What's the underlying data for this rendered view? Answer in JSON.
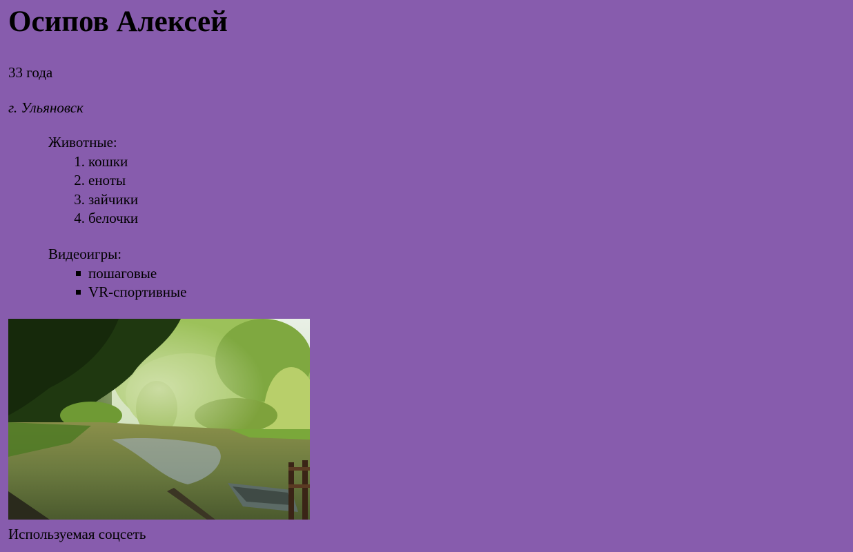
{
  "profile": {
    "name": "Осипов Алексей",
    "age": "33 года",
    "city": "г. Ульяновск"
  },
  "animals": {
    "title": "Животные:",
    "items": [
      {
        "num": "1.",
        "label": "кошки"
      },
      {
        "num": "2.",
        "label": "еноты"
      },
      {
        "num": "3.",
        "label": "зайчики"
      },
      {
        "num": "4.",
        "label": "белочки"
      }
    ]
  },
  "games": {
    "title": "Видеоигры:",
    "items": [
      {
        "label": "пошаговые"
      },
      {
        "label": "VR-спортивные"
      }
    ]
  },
  "photo": {
    "subject": "park pond with trees and boat"
  },
  "footer": {
    "social_label": "Используемая соцсеть"
  },
  "colors": {
    "background": "#875cad",
    "text": "#000000"
  }
}
